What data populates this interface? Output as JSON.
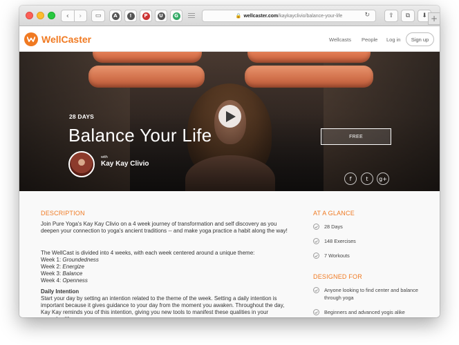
{
  "browser": {
    "url_domain": "wellcaster.com",
    "url_path": "/kaykayclivio/balance-your-life",
    "lock_icon": "🔒",
    "reload_icon": "↻",
    "back_icon": "‹",
    "forward_icon": "›",
    "sidebar_icon": "▭",
    "share_icon": "⇪",
    "tabs_icon": "⧉",
    "download_icon": "⬇",
    "new_tab_icon": "+",
    "ext_badges": [
      "A",
      "!",
      "P",
      "U",
      "G"
    ]
  },
  "nav": {
    "logo_text": "WellCaster",
    "links": [
      "Wellcasts",
      "People",
      "Log in"
    ],
    "signup_label": "Sign up"
  },
  "hero": {
    "days_label": "28 DAYS",
    "title": "Balance Your Life",
    "with_label": "with",
    "instructor": "Kay Kay Clivio",
    "cta_label": "FREE",
    "social": [
      "f",
      "t",
      "g+"
    ]
  },
  "description": {
    "heading": "DESCRIPTION",
    "intro": "Join Pure Yoga's Kay Kay Clivio on a 4 week journey of transformation and self discovery as you deepen your connection to yoga's ancient traditions -- and make yoga practice a habit along the way!",
    "themes_intro": "The WellCast is divided into 4 weeks, with each week centered around a unique theme:",
    "weeks": [
      {
        "label": "Week 1: ",
        "theme": "Groundedness"
      },
      {
        "label": "Week 2: ",
        "theme": "Energize"
      },
      {
        "label": "Week 3: ",
        "theme": "Balance"
      },
      {
        "label": "Week 4: ",
        "theme": "Openness"
      }
    ],
    "daily_heading": "Daily Intention",
    "daily_text": "Start your day by setting an intention related to the theme of the week. Setting a daily intention is important because it gives guidance to your day from the moment you awaken. Throughout the day, Kay Kay reminds you of this intention, giving you new tools to manifest these qualities in your everyday life."
  },
  "glance": {
    "heading": "AT A GLANCE",
    "items": [
      "28 Days",
      "148 Exercises",
      "7 Workouts"
    ]
  },
  "designed_for": {
    "heading": "DESIGNED FOR",
    "items": [
      "Anyone looking to find center and balance through yoga",
      "Beginners and advanced yogis alike"
    ]
  },
  "colors": {
    "brand_orange": "#f07a22",
    "text_dark": "#333333",
    "hero_bg": "#3a2e28"
  }
}
